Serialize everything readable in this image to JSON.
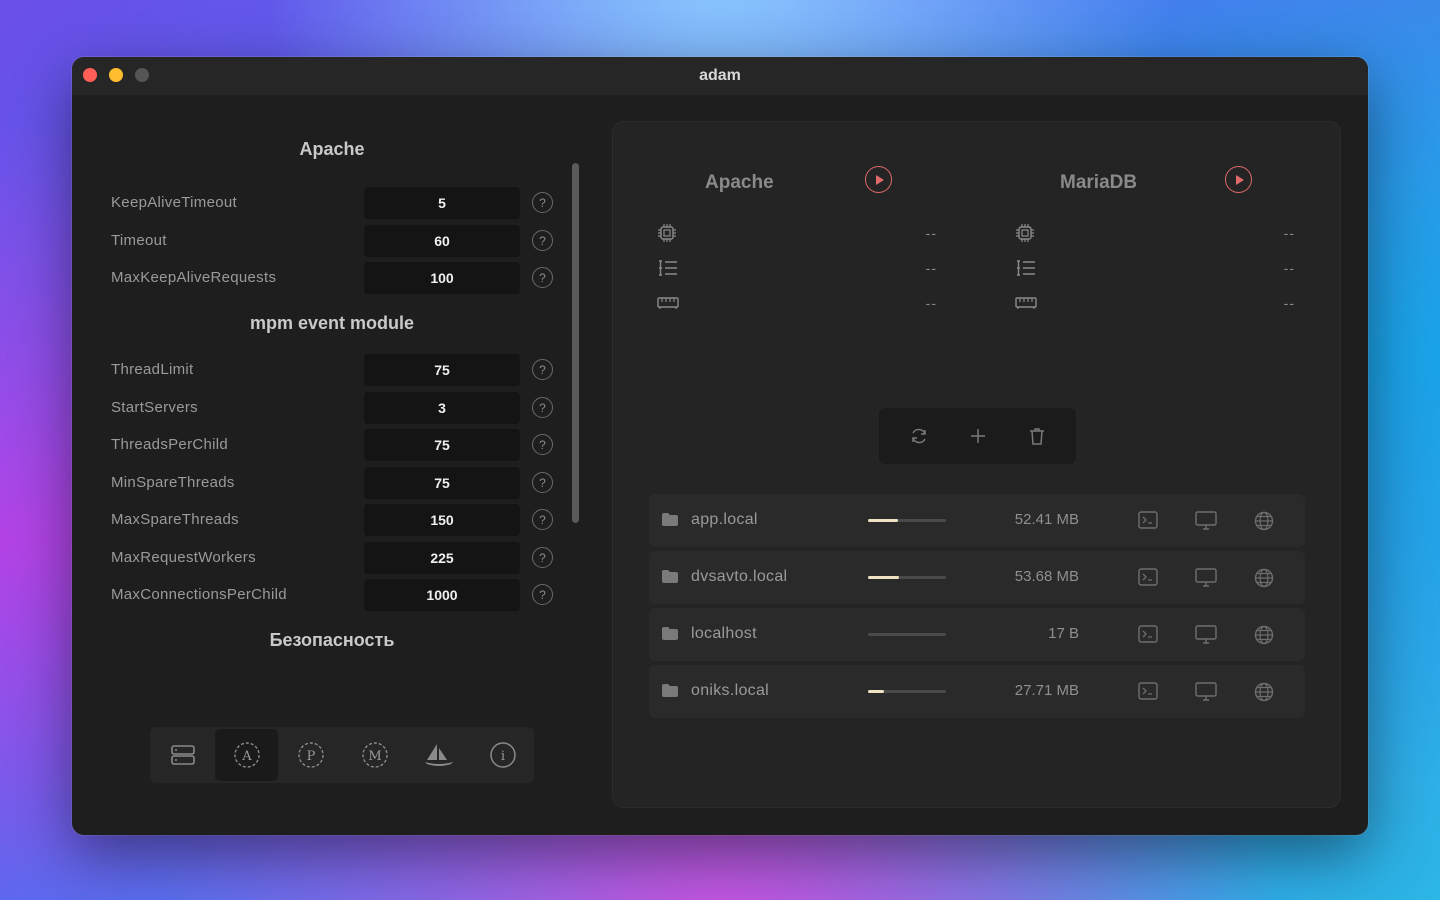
{
  "window": {
    "title": "adam"
  },
  "left": {
    "sections": {
      "apache": "Apache",
      "mpm": "mpm event module",
      "security": "Безопасность"
    },
    "apache_settings": [
      {
        "label": "KeepAliveTimeout",
        "value": "5"
      },
      {
        "label": "Timeout",
        "value": "60"
      },
      {
        "label": "MaxKeepAliveRequests",
        "value": "100"
      }
    ],
    "mpm_settings": [
      {
        "label": "ThreadLimit",
        "value": "75"
      },
      {
        "label": "StartServers",
        "value": "3"
      },
      {
        "label": "ThreadsPerChild",
        "value": "75"
      },
      {
        "label": "MinSpareThreads",
        "value": "75"
      },
      {
        "label": "MaxSpareThreads",
        "value": "150"
      },
      {
        "label": "MaxRequestWorkers",
        "value": "225"
      },
      {
        "label": "MaxConnectionsPerChild",
        "value": "1000"
      }
    ],
    "help_glyph": "?",
    "nav": [
      {
        "icon": "server-icon"
      },
      {
        "icon": "apache-a-icon",
        "glyph": "A",
        "active": true
      },
      {
        "icon": "php-p-icon",
        "glyph": "P"
      },
      {
        "icon": "mariadb-m-icon",
        "glyph": "M"
      },
      {
        "icon": "sailboat-icon"
      },
      {
        "icon": "info-icon",
        "glyph": "i"
      }
    ]
  },
  "right": {
    "services": [
      {
        "name": "Apache",
        "cpu": "--",
        "threads": "--",
        "memory": "--"
      },
      {
        "name": "MariaDB",
        "cpu": "--",
        "threads": "--",
        "memory": "--"
      }
    ],
    "actions": [
      "refresh-icon",
      "plus-icon",
      "trash-icon"
    ],
    "hosts": [
      {
        "name": "app.local",
        "size": "52.41 MB",
        "usage": 0.39
      },
      {
        "name": "dvsavto.local",
        "size": "53.68 MB",
        "usage": 0.4
      },
      {
        "name": "localhost",
        "size": "17 B",
        "usage": 0.0
      },
      {
        "name": "oniks.local",
        "size": "27.71 MB",
        "usage": 0.2
      }
    ]
  },
  "colors": {
    "accent_play": "#e06a6a",
    "usage_fill": "#f0e3c4"
  }
}
